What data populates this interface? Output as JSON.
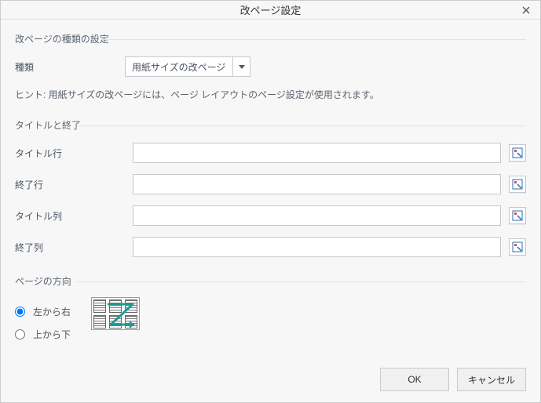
{
  "dialog": {
    "title": "改ページ設定"
  },
  "group1": {
    "title": "改ページの種類の設定",
    "type_label": "種類",
    "type_value": "用紙サイズの改ページ",
    "hint": "ヒント: 用紙サイズの改ページには、ページ レイアウトのページ設定が使用されます。"
  },
  "group2": {
    "title": "タイトルと終了",
    "title_row_label": "タイトル行",
    "title_row_value": "",
    "end_row_label": "終了行",
    "end_row_value": "",
    "title_col_label": "タイトル列",
    "title_col_value": "",
    "end_col_label": "終了列",
    "end_col_value": ""
  },
  "group3": {
    "title": "ページの方向",
    "ltr_label": "左から右",
    "ttb_label": "上から下",
    "selected": "ltr"
  },
  "buttons": {
    "ok": "OK",
    "cancel": "キャンセル"
  }
}
